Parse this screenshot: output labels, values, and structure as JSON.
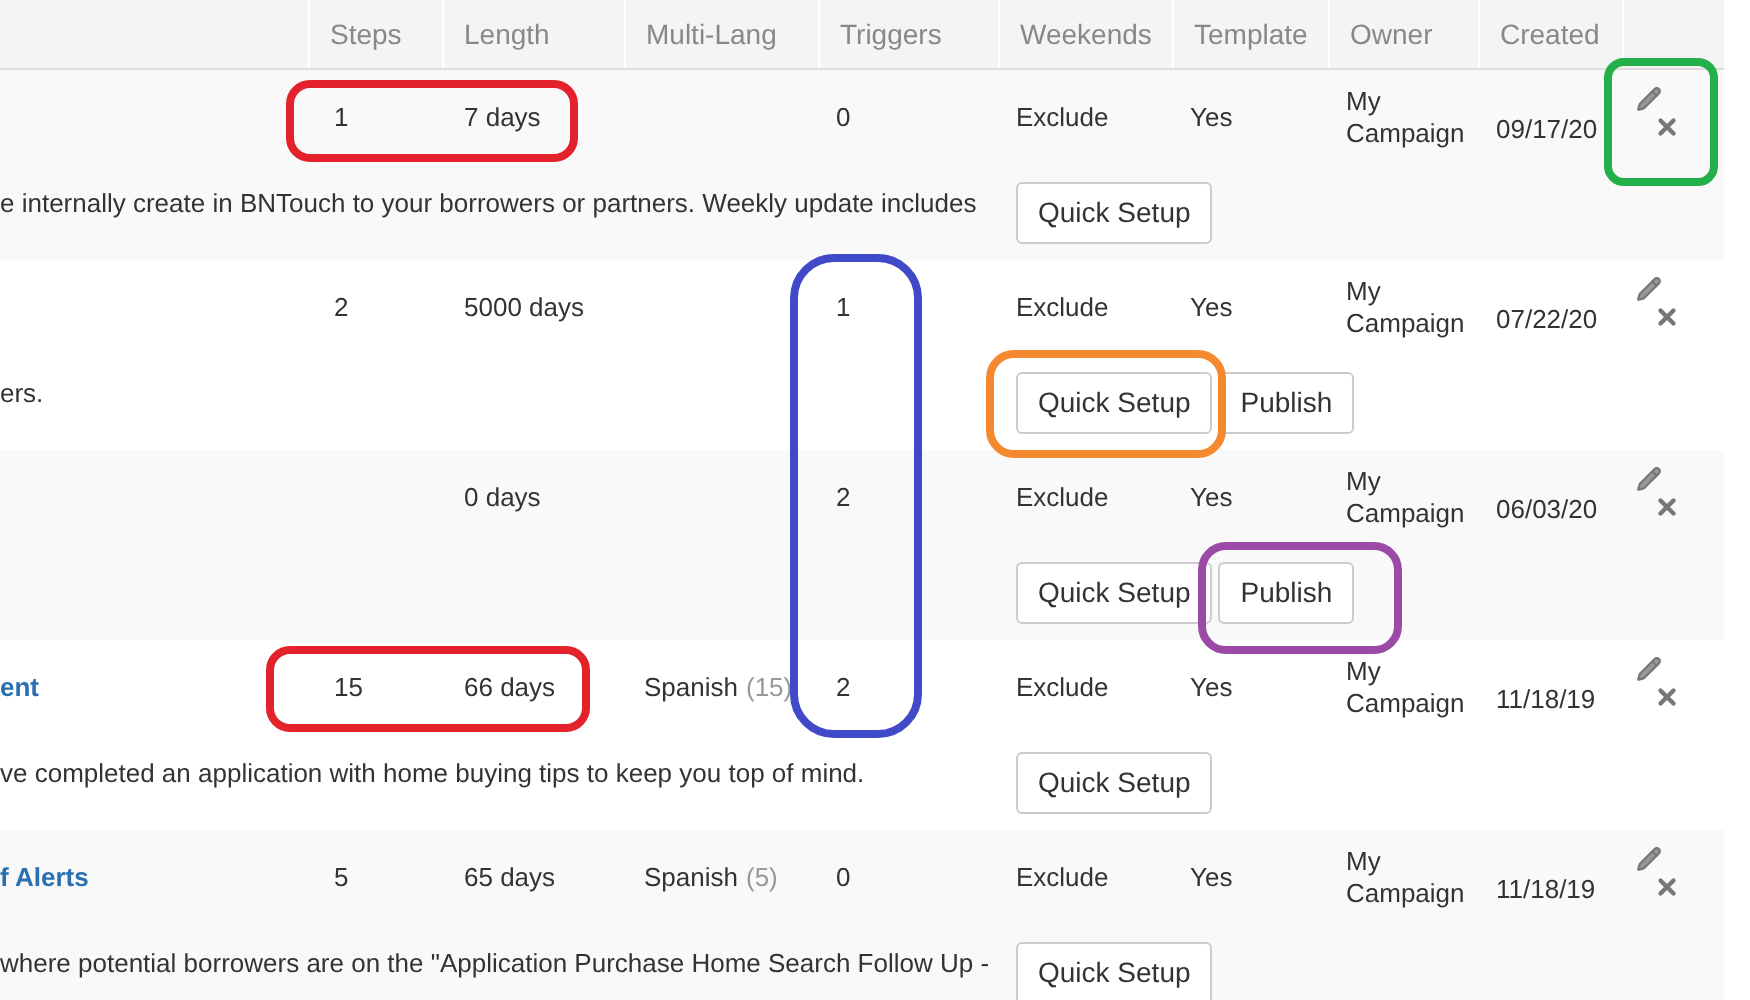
{
  "table": {
    "columns": [
      "Steps",
      "Length",
      "Multi-Lang",
      "Triggers",
      "Weekends",
      "Template",
      "Owner",
      "Created"
    ],
    "rows": [
      {
        "name": "",
        "steps": "1",
        "length": "7 days",
        "language": "",
        "language_count": "",
        "triggers": "0",
        "weekends": "Exclude",
        "template": "Yes",
        "owner": "My Campaign",
        "created": "09/17/20",
        "description": "e internally create in BNTouch to your borrowers or partners. Weekly update includes",
        "buttons": [
          "Quick Setup"
        ]
      },
      {
        "name": "",
        "steps": "2",
        "length": "5000 days",
        "language": "",
        "language_count": "",
        "triggers": "1",
        "weekends": "Exclude",
        "template": "Yes",
        "owner": "My Campaign",
        "created": "07/22/20",
        "description": "ers.",
        "buttons": [
          "Quick Setup",
          "Publish"
        ]
      },
      {
        "name": "",
        "steps": "",
        "length": "0 days",
        "language": "",
        "language_count": "",
        "triggers": "2",
        "weekends": "Exclude",
        "template": "Yes",
        "owner": "My Campaign",
        "created": "06/03/20",
        "description": "",
        "buttons": [
          "Quick Setup",
          "Publish"
        ]
      },
      {
        "name": "ent",
        "steps": "15",
        "length": "66 days",
        "language": "Spanish",
        "language_count": "(15)",
        "triggers": "2",
        "weekends": "Exclude",
        "template": "Yes",
        "owner": "My Campaign",
        "created": "11/18/19",
        "description": "ve completed an application with home buying tips to keep you top of mind.",
        "buttons": [
          "Quick Setup"
        ]
      },
      {
        "name": "f Alerts",
        "steps": "5",
        "length": "65 days",
        "language": "Spanish",
        "language_count": "(5)",
        "triggers": "0",
        "weekends": "Exclude",
        "template": "Yes",
        "owner": "My Campaign",
        "created": "11/18/19",
        "description": "where potential borrowers are on the \"Application Purchase Home Search Follow Up -",
        "buttons": [
          "Quick Setup"
        ]
      }
    ]
  },
  "annotations": [
    {
      "color": "#e3222b",
      "kind": "steps"
    },
    {
      "color": "#e3222b",
      "kind": "stepsLower"
    },
    {
      "color": "#4049c8",
      "kind": "triggers"
    },
    {
      "color": "#f5892f",
      "kind": "setup"
    },
    {
      "color": "#9b4aa6",
      "kind": "publish"
    },
    {
      "color": "#23b04a",
      "kind": "actions"
    }
  ]
}
